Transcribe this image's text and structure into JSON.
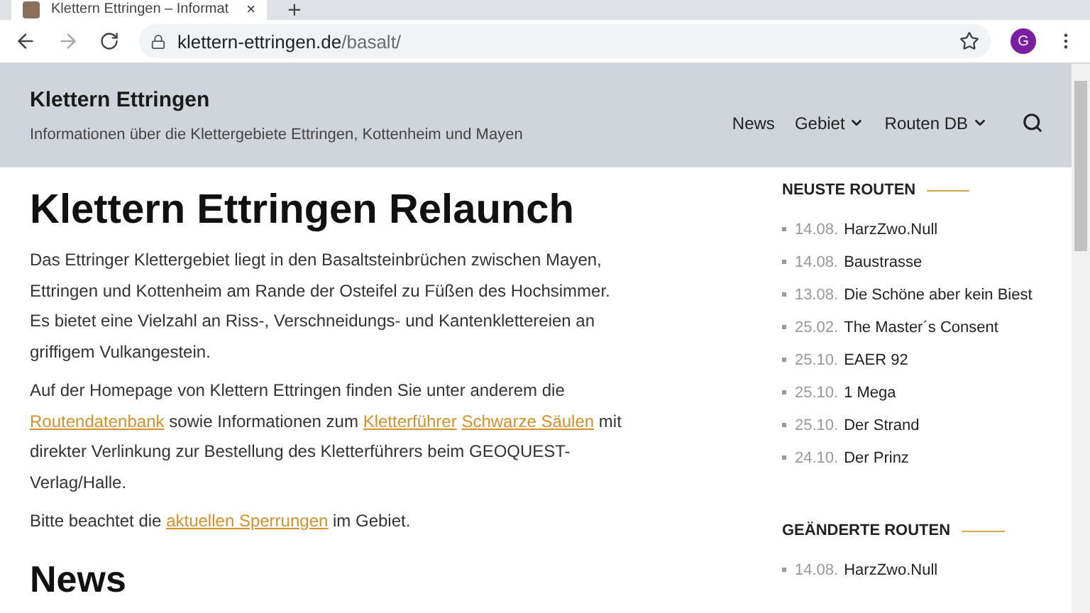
{
  "browser": {
    "tab": {
      "title": "Klettern Ettringen – Informat",
      "close": "×"
    },
    "new_tab": "+",
    "url": {
      "host": "klettern-ettringen.de",
      "path": "/basalt/"
    },
    "profile_initial": "G"
  },
  "header": {
    "site_title": "Klettern Ettringen",
    "tagline": "Informationen über die Klettergebiete Ettringen, Kottenheim und Mayen",
    "nav": [
      {
        "label": "News",
        "dropdown": false
      },
      {
        "label": "Gebiet",
        "dropdown": true
      },
      {
        "label": "Routen DB",
        "dropdown": true
      }
    ]
  },
  "article": {
    "title": "Klettern Ettringen Relaunch",
    "paragraphs": [
      [
        {
          "kind": "text",
          "text": "Das Ettringer Klettergebiet liegt in den Basaltsteinbrüchen zwischen Mayen, Ettringen und Kottenheim am Rande der Osteifel zu Füßen des Hochsimmer. Es bietet eine Vielzahl an Riss-, Verschneidungs- und Kantenklettereien an griffigem Vulkangestein."
        }
      ],
      [
        {
          "kind": "text",
          "text": "Auf der Homepage von Klettern Ettringen finden Sie unter anderem die "
        },
        {
          "kind": "link",
          "text": "Routendatenbank"
        },
        {
          "kind": "text",
          "text": " sowie Informationen zum "
        },
        {
          "kind": "link",
          "text": "Kletterführer"
        },
        {
          "kind": "link",
          "text": "Schwarze Säulen"
        },
        {
          "kind": "text",
          "text": " mit direkter Verlinkung zur Bestellung des Kletterführers beim GEOQUEST-Verlag/Halle."
        }
      ],
      [
        {
          "kind": "text",
          "text": "Bitte beachtet die "
        },
        {
          "kind": "link",
          "text": "aktuellen Sperrungen"
        },
        {
          "kind": "text",
          "text": " im Gebiet."
        }
      ]
    ],
    "next_heading": "News"
  },
  "sidebar": [
    {
      "title": "NEUSTE ROUTEN",
      "items": [
        {
          "date": "14.08.",
          "name": "HarzZwo.Null"
        },
        {
          "date": "14.08.",
          "name": "Baustrasse"
        },
        {
          "date": "13.08.",
          "name": "Die Schöne aber kein Biest"
        },
        {
          "date": "25.02.",
          "name": "The Master´s Consent"
        },
        {
          "date": "25.10.",
          "name": "EAER 92"
        },
        {
          "date": "25.10.",
          "name": "1 Mega"
        },
        {
          "date": "25.10.",
          "name": "Der Strand"
        },
        {
          "date": "24.10.",
          "name": "Der Prinz"
        }
      ]
    },
    {
      "title": "GEÄNDERTE ROUTEN",
      "items": [
        {
          "date": "14.08.",
          "name": "HarzZwo.Null"
        }
      ]
    }
  ]
}
